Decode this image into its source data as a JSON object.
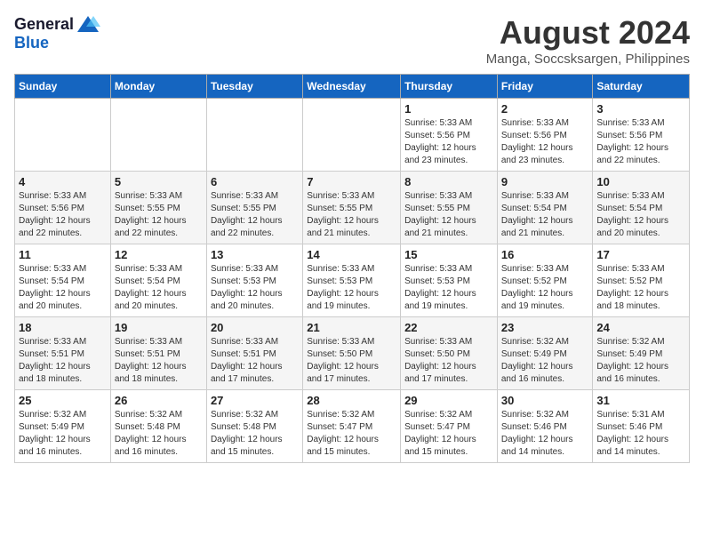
{
  "logo": {
    "general": "General",
    "blue": "Blue"
  },
  "title": "August 2024",
  "location": "Manga, Soccsksargen, Philippines",
  "weekdays": [
    "Sunday",
    "Monday",
    "Tuesday",
    "Wednesday",
    "Thursday",
    "Friday",
    "Saturday"
  ],
  "weeks": [
    [
      {
        "day": "",
        "info": ""
      },
      {
        "day": "",
        "info": ""
      },
      {
        "day": "",
        "info": ""
      },
      {
        "day": "",
        "info": ""
      },
      {
        "day": "1",
        "info": "Sunrise: 5:33 AM\nSunset: 5:56 PM\nDaylight: 12 hours\nand 23 minutes."
      },
      {
        "day": "2",
        "info": "Sunrise: 5:33 AM\nSunset: 5:56 PM\nDaylight: 12 hours\nand 23 minutes."
      },
      {
        "day": "3",
        "info": "Sunrise: 5:33 AM\nSunset: 5:56 PM\nDaylight: 12 hours\nand 22 minutes."
      }
    ],
    [
      {
        "day": "4",
        "info": "Sunrise: 5:33 AM\nSunset: 5:56 PM\nDaylight: 12 hours\nand 22 minutes."
      },
      {
        "day": "5",
        "info": "Sunrise: 5:33 AM\nSunset: 5:55 PM\nDaylight: 12 hours\nand 22 minutes."
      },
      {
        "day": "6",
        "info": "Sunrise: 5:33 AM\nSunset: 5:55 PM\nDaylight: 12 hours\nand 22 minutes."
      },
      {
        "day": "7",
        "info": "Sunrise: 5:33 AM\nSunset: 5:55 PM\nDaylight: 12 hours\nand 21 minutes."
      },
      {
        "day": "8",
        "info": "Sunrise: 5:33 AM\nSunset: 5:55 PM\nDaylight: 12 hours\nand 21 minutes."
      },
      {
        "day": "9",
        "info": "Sunrise: 5:33 AM\nSunset: 5:54 PM\nDaylight: 12 hours\nand 21 minutes."
      },
      {
        "day": "10",
        "info": "Sunrise: 5:33 AM\nSunset: 5:54 PM\nDaylight: 12 hours\nand 20 minutes."
      }
    ],
    [
      {
        "day": "11",
        "info": "Sunrise: 5:33 AM\nSunset: 5:54 PM\nDaylight: 12 hours\nand 20 minutes."
      },
      {
        "day": "12",
        "info": "Sunrise: 5:33 AM\nSunset: 5:54 PM\nDaylight: 12 hours\nand 20 minutes."
      },
      {
        "day": "13",
        "info": "Sunrise: 5:33 AM\nSunset: 5:53 PM\nDaylight: 12 hours\nand 20 minutes."
      },
      {
        "day": "14",
        "info": "Sunrise: 5:33 AM\nSunset: 5:53 PM\nDaylight: 12 hours\nand 19 minutes."
      },
      {
        "day": "15",
        "info": "Sunrise: 5:33 AM\nSunset: 5:53 PM\nDaylight: 12 hours\nand 19 minutes."
      },
      {
        "day": "16",
        "info": "Sunrise: 5:33 AM\nSunset: 5:52 PM\nDaylight: 12 hours\nand 19 minutes."
      },
      {
        "day": "17",
        "info": "Sunrise: 5:33 AM\nSunset: 5:52 PM\nDaylight: 12 hours\nand 18 minutes."
      }
    ],
    [
      {
        "day": "18",
        "info": "Sunrise: 5:33 AM\nSunset: 5:51 PM\nDaylight: 12 hours\nand 18 minutes."
      },
      {
        "day": "19",
        "info": "Sunrise: 5:33 AM\nSunset: 5:51 PM\nDaylight: 12 hours\nand 18 minutes."
      },
      {
        "day": "20",
        "info": "Sunrise: 5:33 AM\nSunset: 5:51 PM\nDaylight: 12 hours\nand 17 minutes."
      },
      {
        "day": "21",
        "info": "Sunrise: 5:33 AM\nSunset: 5:50 PM\nDaylight: 12 hours\nand 17 minutes."
      },
      {
        "day": "22",
        "info": "Sunrise: 5:33 AM\nSunset: 5:50 PM\nDaylight: 12 hours\nand 17 minutes."
      },
      {
        "day": "23",
        "info": "Sunrise: 5:32 AM\nSunset: 5:49 PM\nDaylight: 12 hours\nand 16 minutes."
      },
      {
        "day": "24",
        "info": "Sunrise: 5:32 AM\nSunset: 5:49 PM\nDaylight: 12 hours\nand 16 minutes."
      }
    ],
    [
      {
        "day": "25",
        "info": "Sunrise: 5:32 AM\nSunset: 5:49 PM\nDaylight: 12 hours\nand 16 minutes."
      },
      {
        "day": "26",
        "info": "Sunrise: 5:32 AM\nSunset: 5:48 PM\nDaylight: 12 hours\nand 16 minutes."
      },
      {
        "day": "27",
        "info": "Sunrise: 5:32 AM\nSunset: 5:48 PM\nDaylight: 12 hours\nand 15 minutes."
      },
      {
        "day": "28",
        "info": "Sunrise: 5:32 AM\nSunset: 5:47 PM\nDaylight: 12 hours\nand 15 minutes."
      },
      {
        "day": "29",
        "info": "Sunrise: 5:32 AM\nSunset: 5:47 PM\nDaylight: 12 hours\nand 15 minutes."
      },
      {
        "day": "30",
        "info": "Sunrise: 5:32 AM\nSunset: 5:46 PM\nDaylight: 12 hours\nand 14 minutes."
      },
      {
        "day": "31",
        "info": "Sunrise: 5:31 AM\nSunset: 5:46 PM\nDaylight: 12 hours\nand 14 minutes."
      }
    ]
  ]
}
